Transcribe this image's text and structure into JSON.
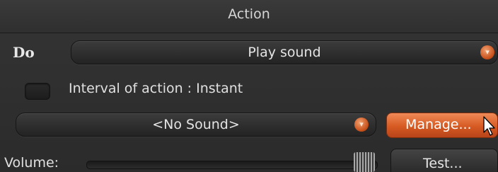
{
  "header": {
    "title": "Action"
  },
  "do_row": {
    "label": "Do",
    "action_combo": {
      "selected": "Play sound",
      "icon": "chevron-down-icon"
    }
  },
  "interval": {
    "checked": false,
    "label": "Interval of action : Instant"
  },
  "sound_row": {
    "sound_combo": {
      "selected": "<No Sound>",
      "icon": "chevron-down-icon"
    },
    "manage_button": "Manage..."
  },
  "volume_row": {
    "label": "Volume:",
    "test_button": "Test..."
  },
  "colors": {
    "accent": "#d65a22",
    "background": "#2d2d2d",
    "text": "#e0e0e0"
  }
}
